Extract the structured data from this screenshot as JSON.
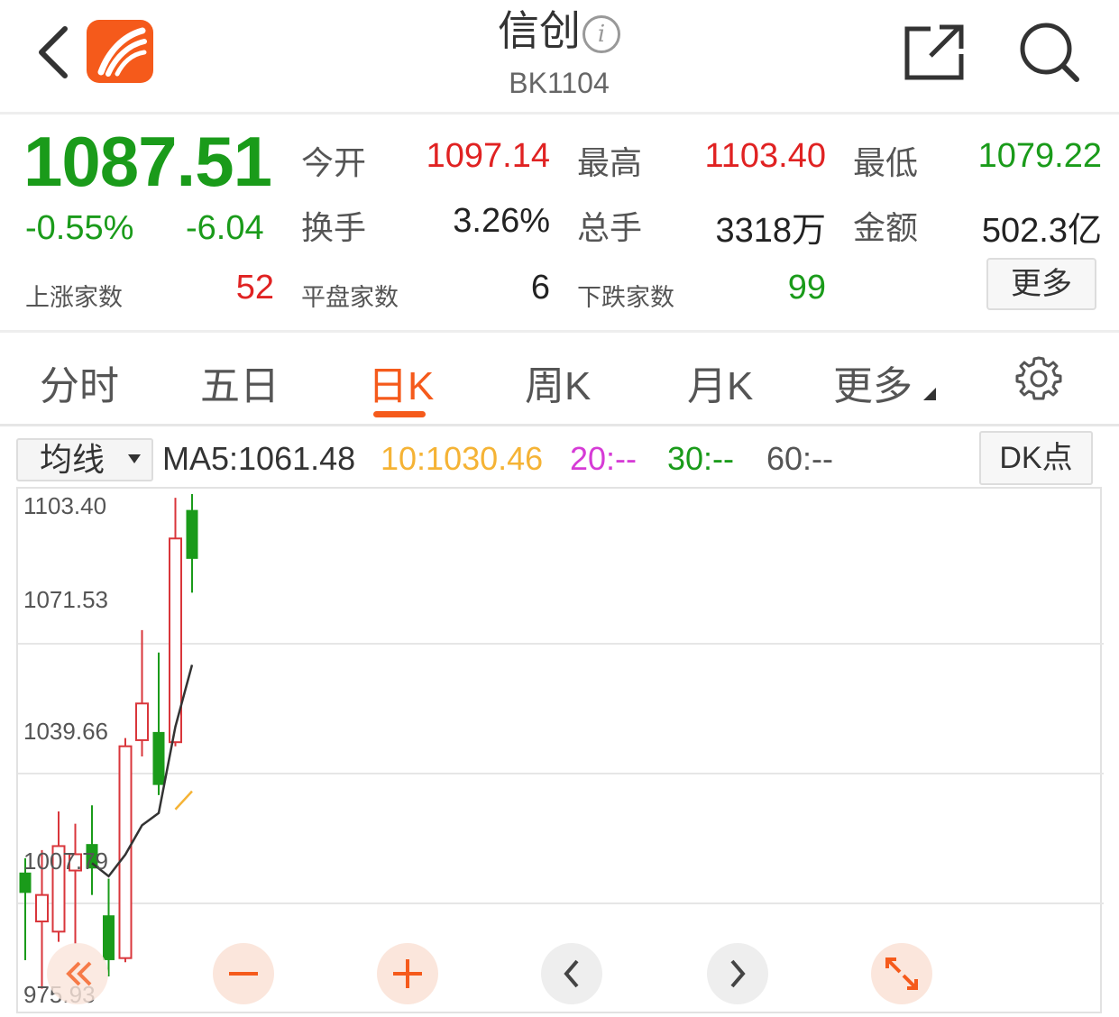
{
  "header": {
    "title": "信创",
    "info_symbol": "i",
    "code": "BK1104"
  },
  "quote": {
    "price": "1087.51",
    "change_pct": "-0.55%",
    "change_val": "-6.04",
    "open_label": "今开",
    "open": "1097.14",
    "high_label": "最高",
    "high": "1103.40",
    "low_label": "最低",
    "low": "1079.22",
    "turnover_label": "换手",
    "turnover": "3.26%",
    "volume_label": "总手",
    "volume": "3318万",
    "amount_label": "金额",
    "amount": "502.3亿",
    "up_label": "上涨家数",
    "up": "52",
    "flat_label": "平盘家数",
    "flat": "6",
    "down_label": "下跌家数",
    "down": "99",
    "more": "更多"
  },
  "tabs": [
    "分时",
    "五日",
    "日K",
    "周K",
    "月K",
    "更多"
  ],
  "active_tab": "日K",
  "ma": {
    "select": "均线",
    "ma5": "MA5:1061.48",
    "ma10": "10:1030.46",
    "ma20": "20:--",
    "ma30": "30:--",
    "ma60": "60:--",
    "dk": "DK点",
    "colors": {
      "ma5": "#333333",
      "ma10": "#f5b335",
      "ma20": "#d63bd6",
      "ma30": "#1a9b1a",
      "ma60": "#555555"
    }
  },
  "chart_data": {
    "type": "candlestick",
    "ylabels": [
      "1103.40",
      "1071.53",
      "1039.66",
      "1007.79",
      "975.93"
    ],
    "ylim": [
      975.93,
      1103.4
    ],
    "candles": [
      {
        "open": 1010.5,
        "close": 1005.5,
        "high": 1014.0,
        "low": 989.0,
        "dir": "down"
      },
      {
        "open": 998.5,
        "close": 1005.0,
        "high": 1016.0,
        "low": 982.0,
        "dir": "up"
      },
      {
        "open": 996.0,
        "close": 1017.0,
        "high": 1025.5,
        "low": 993.5,
        "dir": "up"
      },
      {
        "open": 1011.0,
        "close": 1015.0,
        "high": 1022.5,
        "low": 993.0,
        "dir": "up"
      },
      {
        "open": 1017.5,
        "close": 1011.5,
        "high": 1027.0,
        "low": 1005.0,
        "dir": "down"
      },
      {
        "open": 1000.0,
        "close": 989.0,
        "high": 1009.0,
        "low": 985.0,
        "dir": "down"
      },
      {
        "open": 989.5,
        "close": 1041.5,
        "high": 1043.5,
        "low": 988.5,
        "dir": "up"
      },
      {
        "open": 1043.0,
        "close": 1052.0,
        "high": 1070.0,
        "low": 1039.0,
        "dir": "up"
      },
      {
        "open": 1045.0,
        "close": 1032.0,
        "high": 1064.5,
        "low": 1029.5,
        "dir": "down"
      },
      {
        "open": 1042.5,
        "close": 1092.5,
        "high": 1102.5,
        "low": 1041.5,
        "dir": "up"
      },
      {
        "open": 1099.5,
        "close": 1087.5,
        "high": 1103.4,
        "low": 1079.2,
        "dir": "down"
      }
    ],
    "ma5": [
      null,
      null,
      null,
      null,
      1012.8,
      1009.6,
      1014.9,
      1022.1,
      1025.1,
      1046.3,
      1061.48
    ],
    "ma10": [
      null,
      null,
      null,
      null,
      null,
      null,
      null,
      null,
      null,
      1026.0,
      1030.46
    ]
  },
  "controls": [
    "rewind-icon",
    "zoom-out-icon",
    "zoom-in-icon",
    "prev-icon",
    "next-icon",
    "fullscreen-icon"
  ]
}
